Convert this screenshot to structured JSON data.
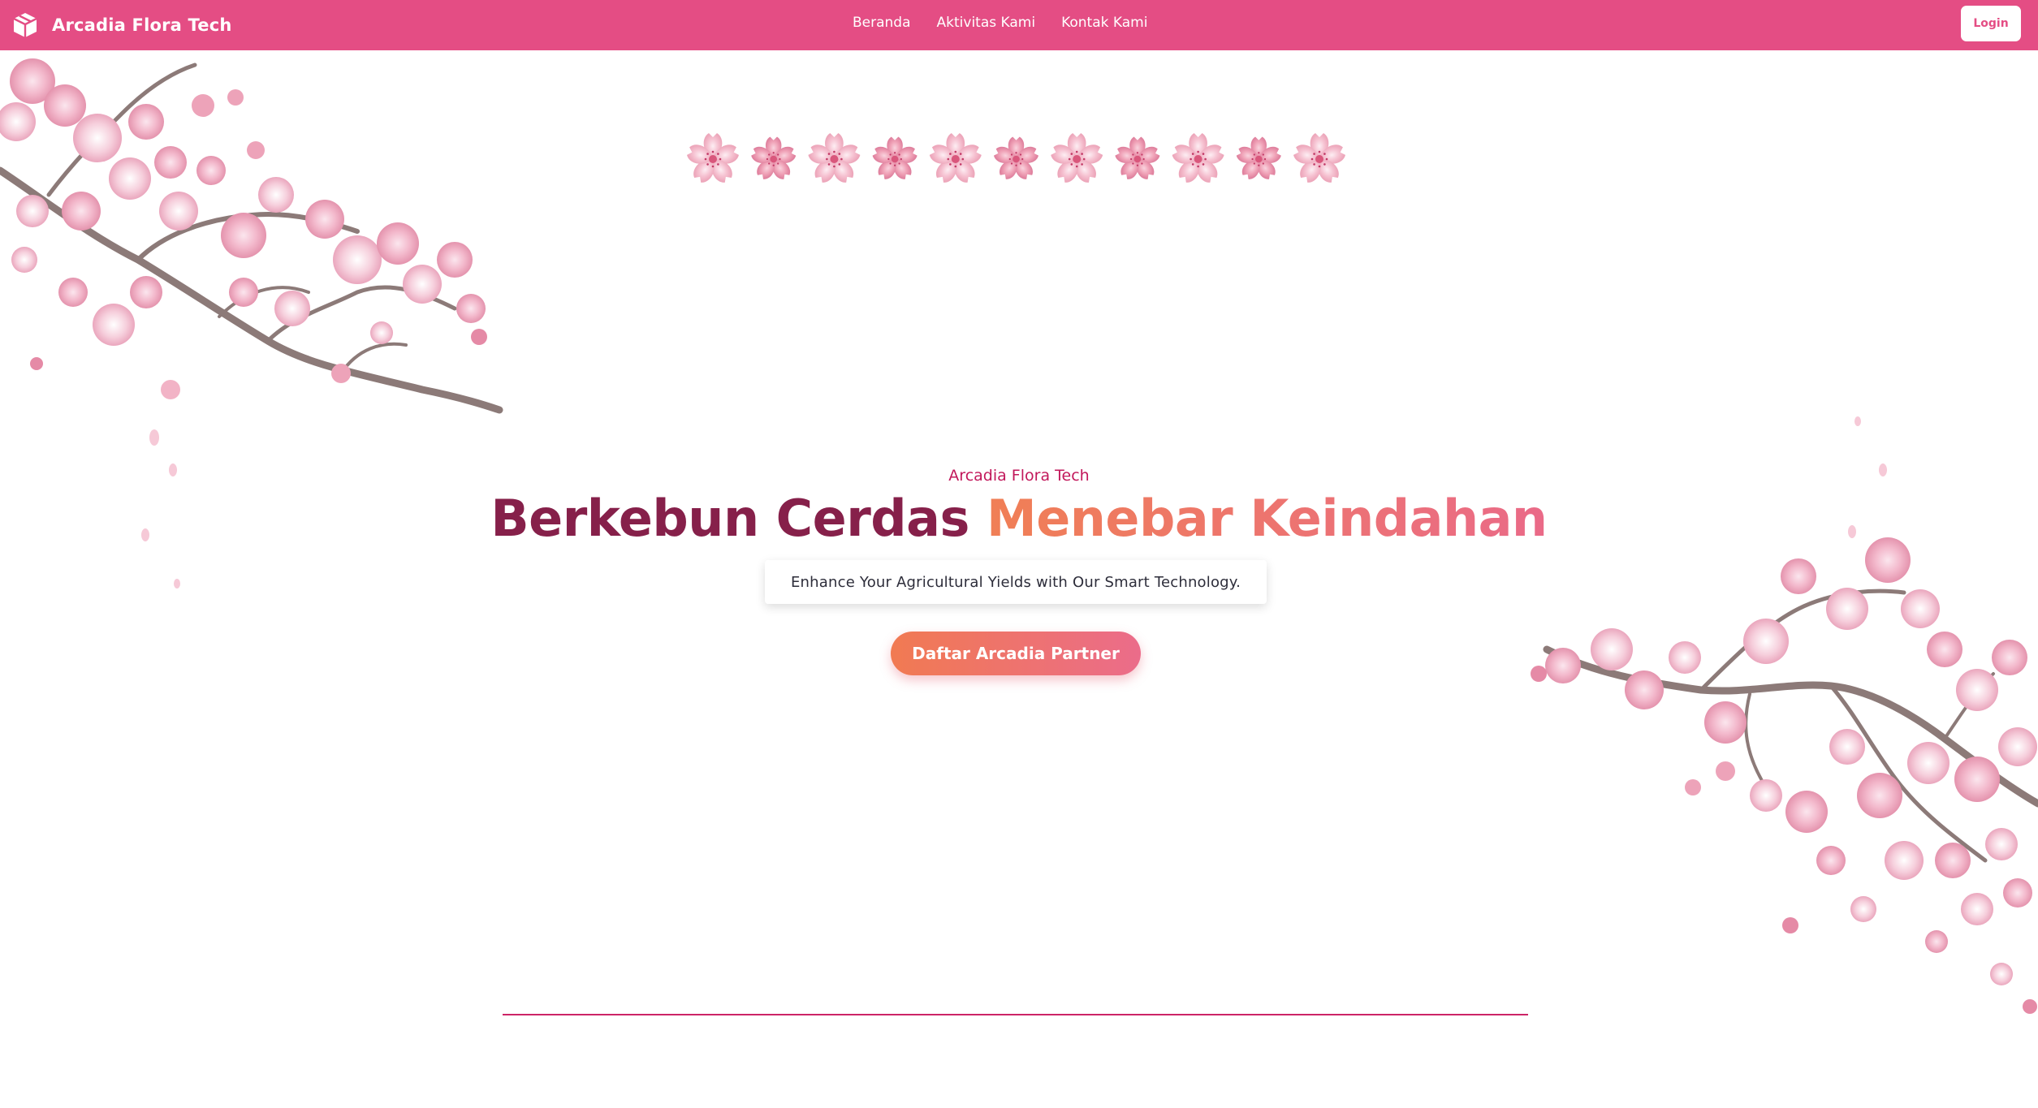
{
  "navbar": {
    "brand_name": "Arcadia Flora Tech",
    "brand_icon": "cube-icon",
    "links": [
      "Beranda",
      "Aktivitas Kami",
      "Kontak Kami"
    ],
    "login_label": "Login"
  },
  "hero": {
    "kicker": "Arcadia Flora Tech",
    "title_part1": "Berkebun Cerdas",
    "title_part2": "Menebar Keindahan",
    "tagline": "Enhance Your Agricultural Yields with Our Smart Technology.",
    "cta_label": "Daftar Arcadia Partner"
  },
  "decoration": {
    "flower_count": 11,
    "flower_icon": "sakura-flower-icon",
    "branch_icon": "cherry-blossom-branch-icon"
  },
  "colors": {
    "navbar_bg": "#e44d84",
    "title_dark": "#86204a",
    "accent_orange": "#f07f55",
    "accent_pink": "#ea6a88",
    "kicker": "#c2185b",
    "divider": "#cc2466"
  }
}
